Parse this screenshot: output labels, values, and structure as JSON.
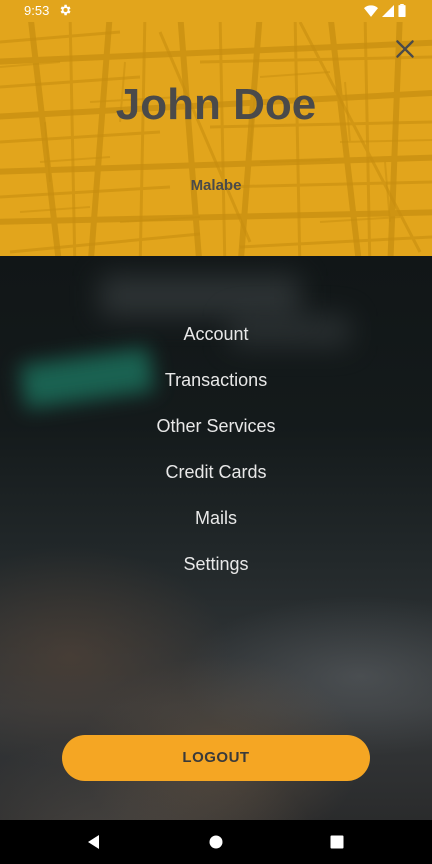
{
  "status_bar": {
    "time": "9:53",
    "icons": [
      "gear-icon",
      "wifi-icon",
      "signal-icon",
      "battery-icon"
    ]
  },
  "header": {
    "name": "John Doe",
    "location": "Malabe",
    "close_icon": "close-icon"
  },
  "menu": {
    "items": [
      {
        "label": "Account"
      },
      {
        "label": "Transactions"
      },
      {
        "label": "Other Services"
      },
      {
        "label": "Credit Cards"
      },
      {
        "label": "Mails"
      },
      {
        "label": "Settings"
      }
    ]
  },
  "logout": {
    "label": "LOGOUT"
  },
  "nav_bar": {
    "icons": [
      "back-icon",
      "home-icon",
      "recents-icon"
    ]
  },
  "colors": {
    "accent": "#e2a51c",
    "button": "#f5a623",
    "text_dark": "#4a4a4a",
    "menu_text": "#e8e8e8"
  }
}
